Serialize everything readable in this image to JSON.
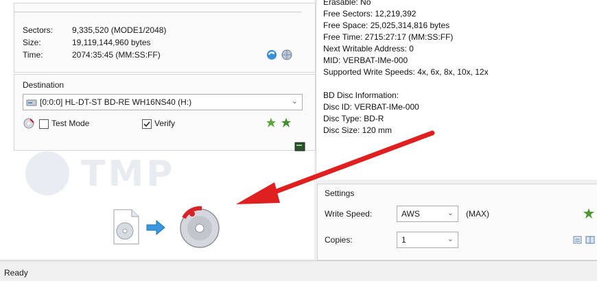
{
  "source": {
    "sectors_label": "Sectors:",
    "sectors_value": "9,335,520 (MODE1/2048)",
    "size_label": "Size:",
    "size_value": "19,119,144,960 bytes",
    "time_label": "Time:",
    "time_value": "2074:35:45 (MM:SS:FF)"
  },
  "destination": {
    "title": "Destination",
    "drive": "[0:0:0] HL-DT-ST BD-RE  WH16NS40 (H:)",
    "test_mode_label": "Test Mode",
    "test_mode_checked": false,
    "verify_label": "Verify",
    "verify_checked": true
  },
  "disc_info": {
    "lines": [
      "Erasable: No",
      "Free Sectors: 12,219,392",
      "Free Space: 25,025,314,816 bytes",
      "Free Time: 2715:27:17 (MM:SS:FF)",
      "Next Writable Address: 0",
      "MID: VERBAT-IMe-000",
      "Supported Write Speeds: 4x, 6x, 8x, 10x, 12x"
    ],
    "bd_lines": [
      "BD Disc Information:",
      "Disc ID: VERBAT-IMe-000",
      "Disc Type: BD-R",
      "Disc Size: 120 mm"
    ]
  },
  "settings": {
    "title": "Settings",
    "write_speed_label": "Write Speed:",
    "write_speed_value": "AWS",
    "write_speed_extra": "(MAX)",
    "copies_label": "Copies:",
    "copies_value": "1"
  },
  "watermark": "TMP",
  "status": {
    "text": "Ready"
  },
  "colors": {
    "arrow": "#e02020",
    "accent_blue": "#2a8fd8",
    "disc_red": "#d8232a"
  }
}
